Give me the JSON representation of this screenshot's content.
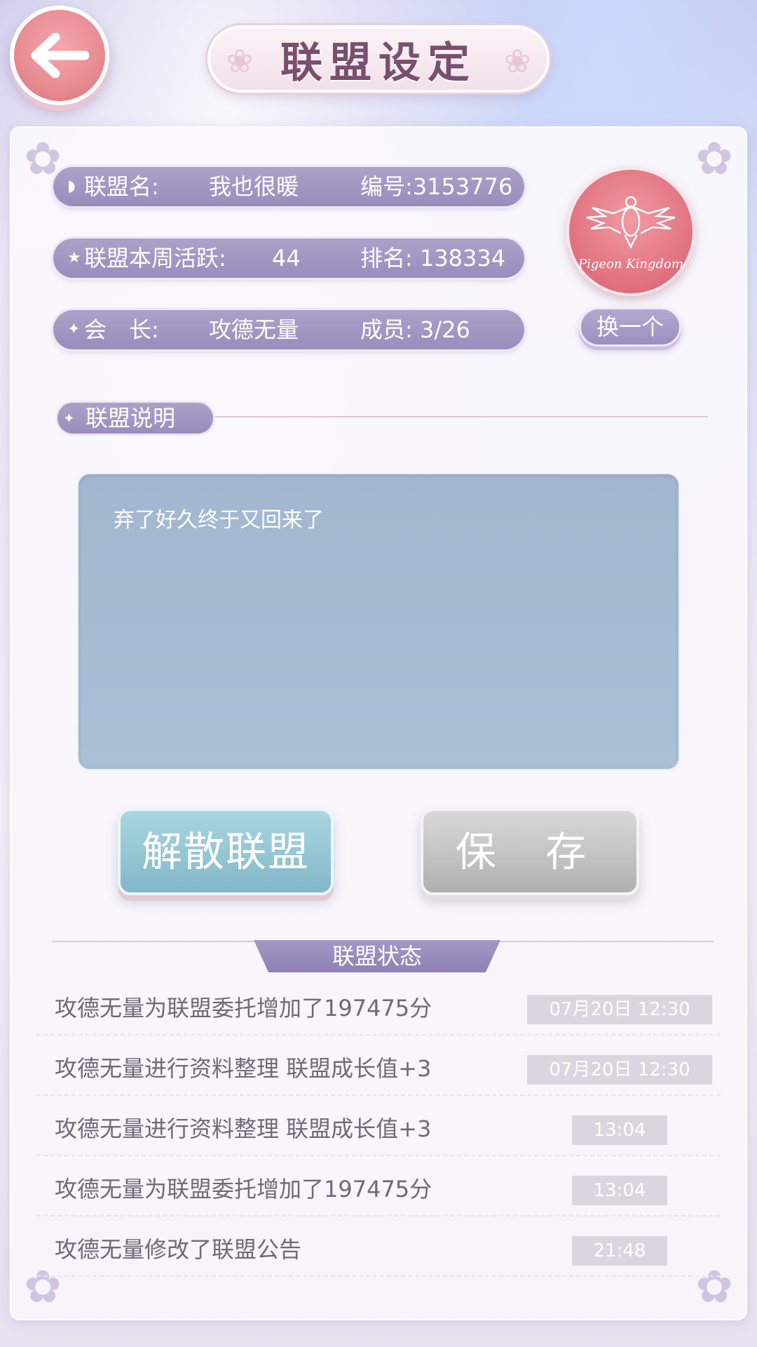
{
  "header": {
    "back_icon": "arrow-left-icon",
    "title": "联盟设定"
  },
  "info": {
    "rows": [
      {
        "icon": "shield-icon",
        "label": "联盟名:",
        "value": "我也很暖",
        "label2": "编号:3153776"
      },
      {
        "icon": "star-icon",
        "label": "联盟本周活跃:",
        "value": "44",
        "label2": "排名: 138334"
      },
      {
        "icon": "sparkle-icon",
        "label": "会　长:",
        "value": "攻德无量",
        "label2": "成员:  3/26"
      }
    ],
    "emblem_caption": "Pigeon Kingdom",
    "change_label": "换一个"
  },
  "description": {
    "section_title": "联盟说明",
    "text": "弃了好久终于又回来了"
  },
  "actions": {
    "disband_label": "解散联盟",
    "save_label": "保 存"
  },
  "status": {
    "title": "联盟状态",
    "logs": [
      {
        "text": "攻德无量为联盟委托增加了197475分",
        "time": "07月20日 12:30"
      },
      {
        "text": "攻德无量进行资料整理 联盟成长值+3",
        "time": "07月20日 12:30"
      },
      {
        "text": "攻德无量进行资料整理 联盟成长值+3",
        "time": "13:04"
      },
      {
        "text": "攻德无量为联盟委托增加了197475分",
        "time": "13:04"
      },
      {
        "text": "攻德无量修改了联盟公告",
        "time": "21:48"
      }
    ]
  },
  "colors": {
    "accent_purple": "#9a8cbc",
    "back_button": "#e88b92",
    "emblem": "#e0707d",
    "disband_button": "#82b7c8",
    "save_button": "#b0b0b0",
    "description_box": "#a3b6cf"
  }
}
